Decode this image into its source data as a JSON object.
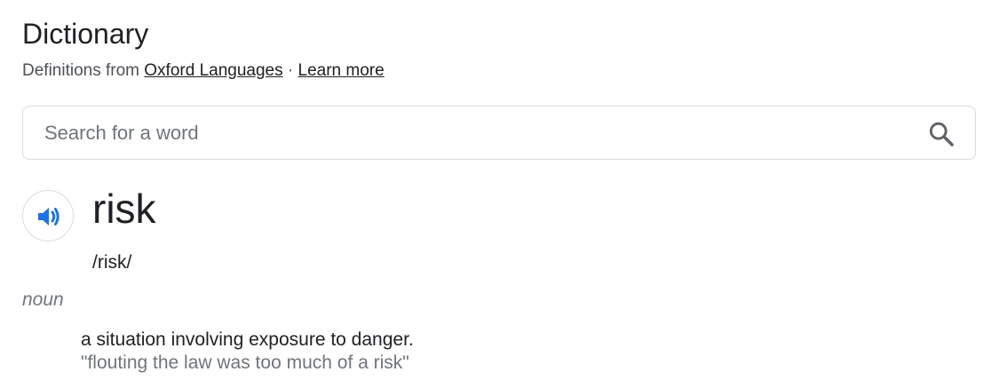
{
  "header": {
    "title": "Dictionary",
    "subtitle_prefix": "Definitions from",
    "source_link": "Oxford Languages",
    "separator": "·",
    "learn_more_link": "Learn more"
  },
  "search": {
    "placeholder": "Search for a word",
    "value": "",
    "icon": "search-icon"
  },
  "entry": {
    "audio_icon": "speaker-icon",
    "word": "risk",
    "phonetic": "/risk/",
    "part_of_speech": "noun",
    "definitions": [
      {
        "text": "a situation involving exposure to danger.",
        "example": "\"flouting the law was too much of a risk\""
      }
    ]
  },
  "colors": {
    "text_primary": "#202124",
    "text_secondary": "#70757a",
    "border": "#dadce0",
    "speaker_accent": "#1a73e8"
  }
}
